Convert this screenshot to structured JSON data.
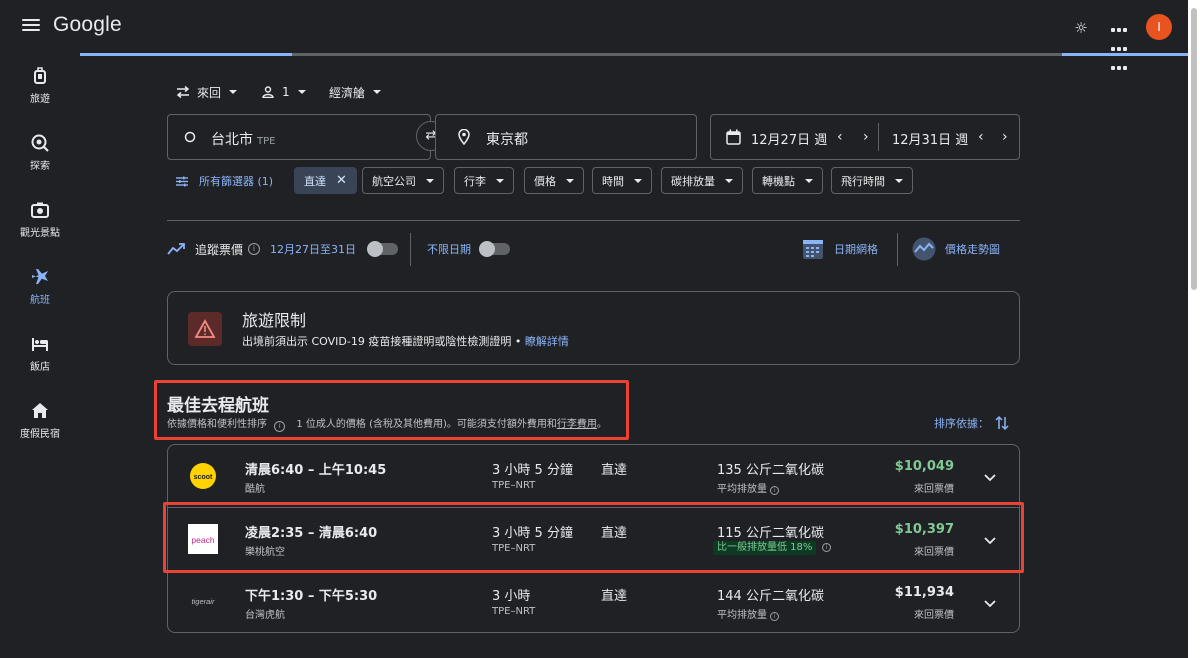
{
  "header": {
    "logo": "Google",
    "avatar_initial": "I"
  },
  "sidebar": {
    "items": [
      {
        "label": "旅遊",
        "icon": "luggage-icon",
        "active": false
      },
      {
        "label": "探索",
        "icon": "explore-icon",
        "active": false
      },
      {
        "label": "觀光景點",
        "icon": "camera-icon",
        "active": false
      },
      {
        "label": "航班",
        "icon": "flight-icon",
        "active": true
      },
      {
        "label": "飯店",
        "icon": "hotel-icon",
        "active": false
      },
      {
        "label": "度假民宿",
        "icon": "home-icon",
        "active": false
      }
    ]
  },
  "search": {
    "trip_type": "來回",
    "passengers": "1",
    "cabin_class": "經濟艙",
    "origin": "台北市",
    "origin_code": "TPE",
    "destination": "東京都",
    "depart_date": "12月27日 週",
    "return_date": "12月31日 週"
  },
  "filters": {
    "all_filters": "所有篩選器 (1)",
    "selected_chip": "直達",
    "chips": [
      "航空公司",
      "行李",
      "價格",
      "時間",
      "碳排放量",
      "轉機點",
      "飛行時間"
    ]
  },
  "tracking": {
    "label": "追蹤票價",
    "date_range": "12月27日至31日",
    "any_dates": "不限日期",
    "date_grid": "日期網格",
    "price_graph": "價格走勢圖"
  },
  "restriction": {
    "title": "旅遊限制",
    "body": "出境前須出示 COVID-19 疫苗接種證明或陰性檢測證明 •",
    "link": "瞭解詳情"
  },
  "results": {
    "title": "最佳去程航班",
    "subtitle_a": "依據價格和便利性排序",
    "subtitle_b": "1 位成人的價格 (含稅及其他費用)。可能須支付額外費用和",
    "subtitle_link": "行李費用",
    "subtitle_end": "。",
    "sort_label": "排序依據："
  },
  "flights": [
    {
      "times": "清晨6:40 – 上午10:45",
      "airline": "酷航",
      "duration": "3 小時 5 分鐘",
      "route": "TPE–NRT",
      "stops": "直達",
      "emissions": "135 公斤二氧化碳",
      "emissions_note": "平均排放量",
      "price": "$10,049",
      "price_note": "來回票價",
      "logo_text": "SCOOT",
      "price_color": "#81c995"
    },
    {
      "times": "凌晨2:35 – 清晨6:40",
      "airline": "樂桃航空",
      "duration": "3 小時 5 分鐘",
      "route": "TPE–NRT",
      "stops": "直達",
      "emissions": "115 公斤二氧化碳",
      "emissions_note": "比一般排放量低 18%",
      "price": "$10,397",
      "price_note": "來回票價",
      "logo_text": "peach",
      "price_color": "#81c995"
    },
    {
      "times": "下午1:30 – 下午5:30",
      "airline": "台灣虎航",
      "duration": "3 小時",
      "route": "TPE–NRT",
      "stops": "直達",
      "emissions": "144 公斤二氧化碳",
      "emissions_note": "平均排放量",
      "price": "$11,934",
      "price_note": "來回票價",
      "logo_text": "tigerair",
      "price_color": "#e8eaed"
    }
  ],
  "colors": {
    "accent": "#8ab4f8",
    "highlight": "#ea4335",
    "price_green": "#81c995"
  }
}
